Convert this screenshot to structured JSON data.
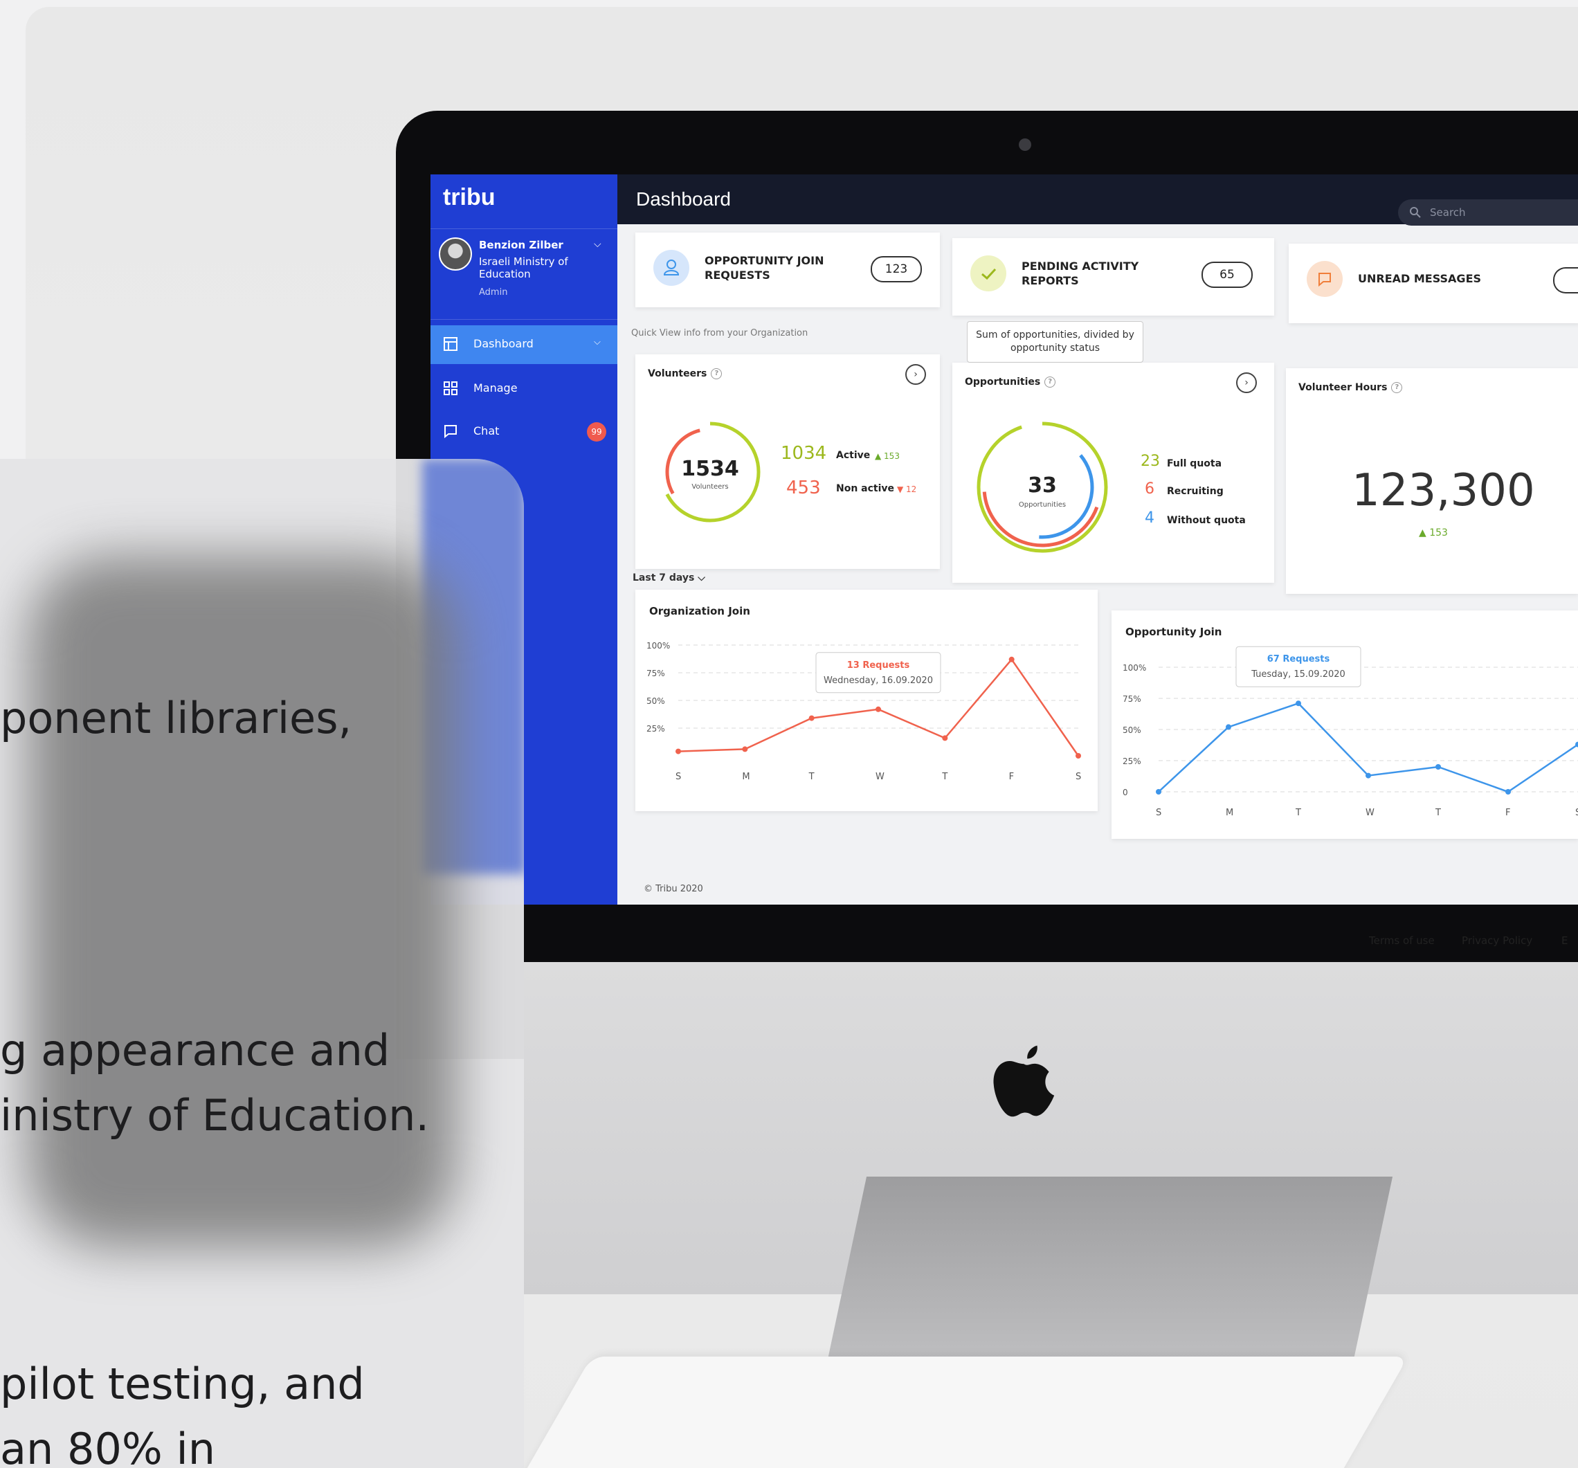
{
  "app": {
    "logo": "tribu",
    "title": "Dashboard",
    "search_placeholder": "Search"
  },
  "profile": {
    "name": "Benzion Zilber",
    "org": "Israeli Ministry of Education",
    "role": "Admin"
  },
  "sidebar": {
    "items": [
      {
        "label": "Dashboard",
        "icon": "dashboard-icon",
        "active": true
      },
      {
        "label": "Manage",
        "icon": "grid-icon",
        "active": false
      },
      {
        "label": "Chat",
        "icon": "chat-icon",
        "active": false,
        "badge": "99"
      }
    ]
  },
  "stats": [
    {
      "label": "OPPORTUNITY JOIN REQUESTS",
      "value": "123",
      "icon": "user-icon",
      "color": "#d6e6fb"
    },
    {
      "label": "PENDING ACTIVITY REPORTS",
      "value": "65",
      "icon": "check-icon",
      "color": "#eef3c2"
    },
    {
      "label": "UNREAD MESSAGES",
      "value": "",
      "icon": "message-icon",
      "color": "#fbe0cd"
    }
  ],
  "quick_view": "Quick View info from your Organization",
  "tooltip": "Sum of opportunities, divided by opportunity status",
  "volunteers": {
    "title": "Volunteers",
    "total": "1534",
    "total_caption": "Volunteers",
    "active_value": "1034",
    "active_label": "Active",
    "active_delta": "▲ 153",
    "nonactive_value": "453",
    "nonactive_label": "Non active",
    "nonactive_delta": "▼ 12",
    "active_fraction": 0.674,
    "nonactive_fraction": 0.295
  },
  "opportunities": {
    "title": "Opportunities",
    "total": "33",
    "total_caption": "Opportunities",
    "items": [
      {
        "value": "23",
        "label": "Full quota",
        "color": "#b5d22b"
      },
      {
        "value": "6",
        "label": "Recruiting",
        "color": "#f0624d"
      },
      {
        "value": "4",
        "label": "Without quota",
        "color": "#3d95ea"
      }
    ]
  },
  "hours": {
    "title": "Volunteer Hours",
    "value": "123,300",
    "delta": "▲ 153"
  },
  "range": "Last 7 days",
  "chart_data": [
    {
      "type": "line",
      "title": "Organization Join",
      "categories": [
        "S",
        "M",
        "T",
        "W",
        "T",
        "F",
        "S"
      ],
      "y_ticks": [
        "100%",
        "75%",
        "50%",
        "25%"
      ],
      "ylim": [
        0,
        100
      ],
      "color": "#f0624d",
      "series": [
        {
          "values": [
            4,
            6,
            34,
            42,
            16,
            87,
            0
          ]
        }
      ],
      "tooltip": {
        "title": "13 Requests",
        "subtitle": "Wednesday, 16.09.2020",
        "index": 3
      }
    },
    {
      "type": "line",
      "title": "Opportunity Join",
      "categories": [
        "S",
        "M",
        "T",
        "W",
        "T",
        "F",
        "S"
      ],
      "y_ticks": [
        "100%",
        "75%",
        "50%",
        "25%",
        "0"
      ],
      "ylim": [
        0,
        100
      ],
      "color": "#3d95ea",
      "series": [
        {
          "values": [
            0,
            52,
            71,
            13,
            20,
            0,
            38
          ]
        }
      ],
      "tooltip": {
        "title": "67 Requests",
        "subtitle": "Tuesday, 15.09.2020",
        "index": 2
      }
    }
  ],
  "footer": {
    "copyright": "© Tribu 2020",
    "links": [
      "Terms of use",
      "Privacy Policy",
      "E"
    ]
  },
  "overlay_text": [
    "ponent libraries,",
    "g appearance and",
    "inistry of Education.",
    "pilot testing, and",
    "an 80% in"
  ]
}
